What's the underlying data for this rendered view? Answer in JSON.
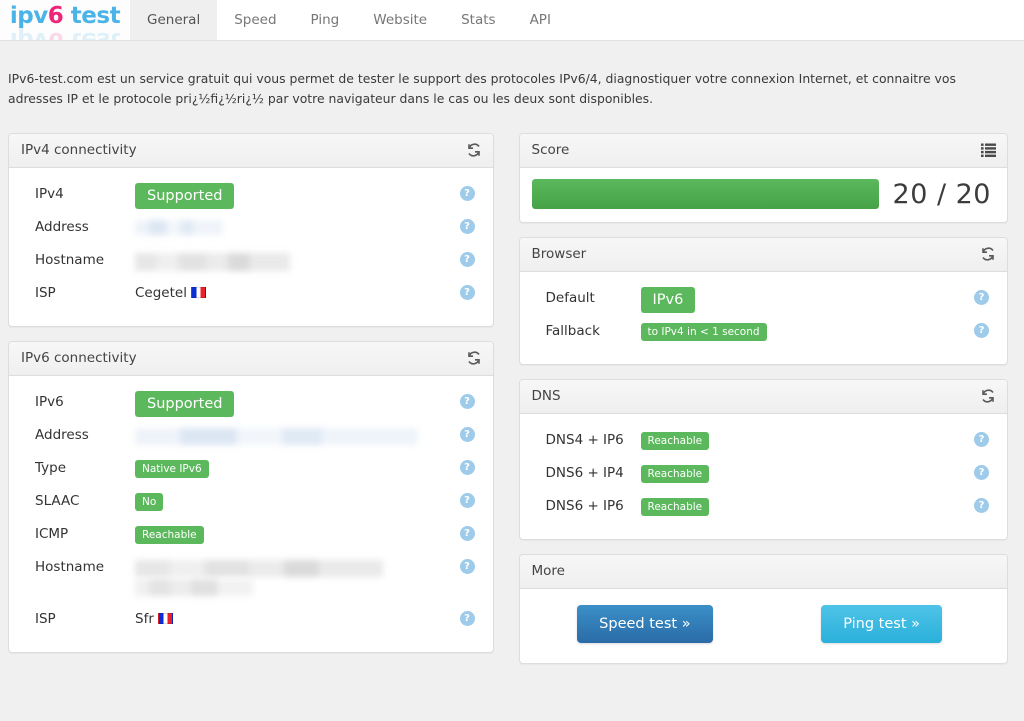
{
  "header": {
    "logo": {
      "prefix": "ipv",
      "highlight": "6",
      "suffix": " test"
    },
    "tabs": [
      {
        "label": "General",
        "active": true
      },
      {
        "label": "Speed",
        "active": false
      },
      {
        "label": "Ping",
        "active": false
      },
      {
        "label": "Website",
        "active": false
      },
      {
        "label": "Stats",
        "active": false
      },
      {
        "label": "API",
        "active": false
      }
    ]
  },
  "intro": {
    "text": "IPv6-test.com est un service gratuit qui vous permet de tester le support des protocoles IPv6/4, diagnostiquer votre connexion Internet, et connaitre vos adresses IP et le protocole pri¿½fi¿½ri¿½ par votre navigateur dans le cas ou les deux sont disponibles."
  },
  "icons": {
    "refresh": "refresh-icon",
    "list": "list-icon",
    "help": "?"
  },
  "colors": {
    "success": "#5cb85c",
    "brand_blue": "#4ab3e8",
    "brand_pink": "#f0257a",
    "help_blue": "#9ecbea",
    "speed_button": "#2a6ca8",
    "ping_button": "#2ab0da"
  },
  "panels": {
    "ipv4": {
      "title": "IPv4 connectivity",
      "rows": [
        {
          "label": "IPv4",
          "kind": "badge",
          "value": "Supported"
        },
        {
          "label": "Address",
          "kind": "redacted",
          "value": ""
        },
        {
          "label": "Hostname",
          "kind": "redacted",
          "value": ""
        },
        {
          "label": "ISP",
          "kind": "text",
          "value": "Cegetel",
          "flag": "FR"
        }
      ]
    },
    "ipv6": {
      "title": "IPv6 connectivity",
      "rows": [
        {
          "label": "IPv6",
          "kind": "badge",
          "value": "Supported"
        },
        {
          "label": "Address",
          "kind": "redacted",
          "value": ""
        },
        {
          "label": "Type",
          "kind": "badge-sm",
          "value": "Native IPv6"
        },
        {
          "label": "SLAAC",
          "kind": "badge-sm",
          "value": "No"
        },
        {
          "label": "ICMP",
          "kind": "badge-sm",
          "value": "Reachable"
        },
        {
          "label": "Hostname",
          "kind": "redacted",
          "value": ""
        },
        {
          "label": "ISP",
          "kind": "text",
          "value": "Sfr",
          "flag": "FR"
        }
      ]
    },
    "score": {
      "title": "Score",
      "value": "20 / 20",
      "percent": 100
    },
    "browser": {
      "title": "Browser",
      "rows": [
        {
          "label": "Default",
          "kind": "badge",
          "value": "IPv6"
        },
        {
          "label": "Fallback",
          "kind": "badge-sm",
          "value": "to IPv4 in < 1 second"
        }
      ]
    },
    "dns": {
      "title": "DNS",
      "rows": [
        {
          "label": "DNS4 + IP6",
          "kind": "badge-sm",
          "value": "Reachable"
        },
        {
          "label": "DNS6 + IP4",
          "kind": "badge-sm",
          "value": "Reachable"
        },
        {
          "label": "DNS6 + IP6",
          "kind": "badge-sm",
          "value": "Reachable"
        }
      ]
    },
    "more": {
      "title": "More",
      "speed_button": "Speed test »",
      "ping_button": "Ping test »"
    }
  }
}
